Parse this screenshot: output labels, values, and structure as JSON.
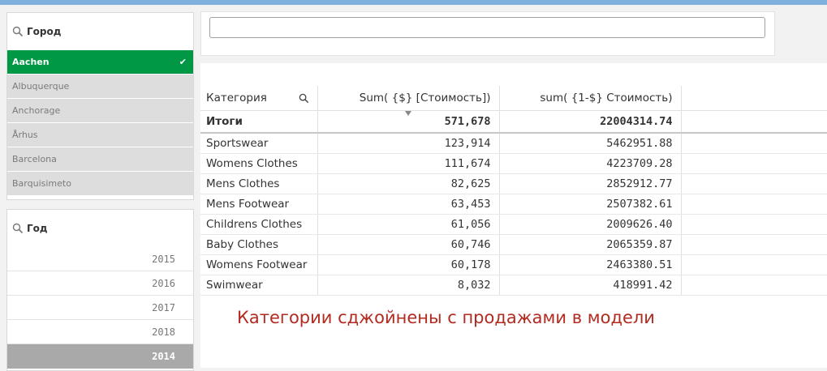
{
  "city_filter": {
    "title": "Город",
    "items": [
      "Aachen",
      "Albuquerque",
      "Anchorage",
      "Århus",
      "Barcelona",
      "Barquisimeto"
    ],
    "selected_index": 0
  },
  "year_filter": {
    "title": "Год",
    "items": [
      "2015",
      "2016",
      "2017",
      "2018",
      "2014"
    ],
    "selected_index": 4
  },
  "search": {
    "value": ""
  },
  "table": {
    "headers": [
      "Категория",
      "Sum( {$} [Стоимость])",
      "sum( {1-$} Стоимость)"
    ],
    "totals": [
      "Итоги",
      "571,678",
      "22004314.74"
    ],
    "rows": [
      [
        "Sportswear",
        "123,914",
        "5462951.88"
      ],
      [
        "Womens Clothes",
        "111,674",
        "4223709.28"
      ],
      [
        "Mens Clothes",
        "82,625",
        "2852912.77"
      ],
      [
        "Mens Footwear",
        "63,453",
        "2507382.61"
      ],
      [
        "Childrens Clothes",
        "61,056",
        "2009626.40"
      ],
      [
        "Baby Clothes",
        "60,746",
        "2065359.87"
      ],
      [
        "Womens Footwear",
        "60,178",
        "2463380.51"
      ],
      [
        "Swimwear",
        "8,032",
        "418991.42"
      ]
    ]
  },
  "note": "Категории сджойнены с продажами в модели",
  "colors": {
    "selected_green": "#009845",
    "selected_gray": "#a9a9a9",
    "note_red": "#b22b20",
    "topbar": "#7fb0dd"
  }
}
